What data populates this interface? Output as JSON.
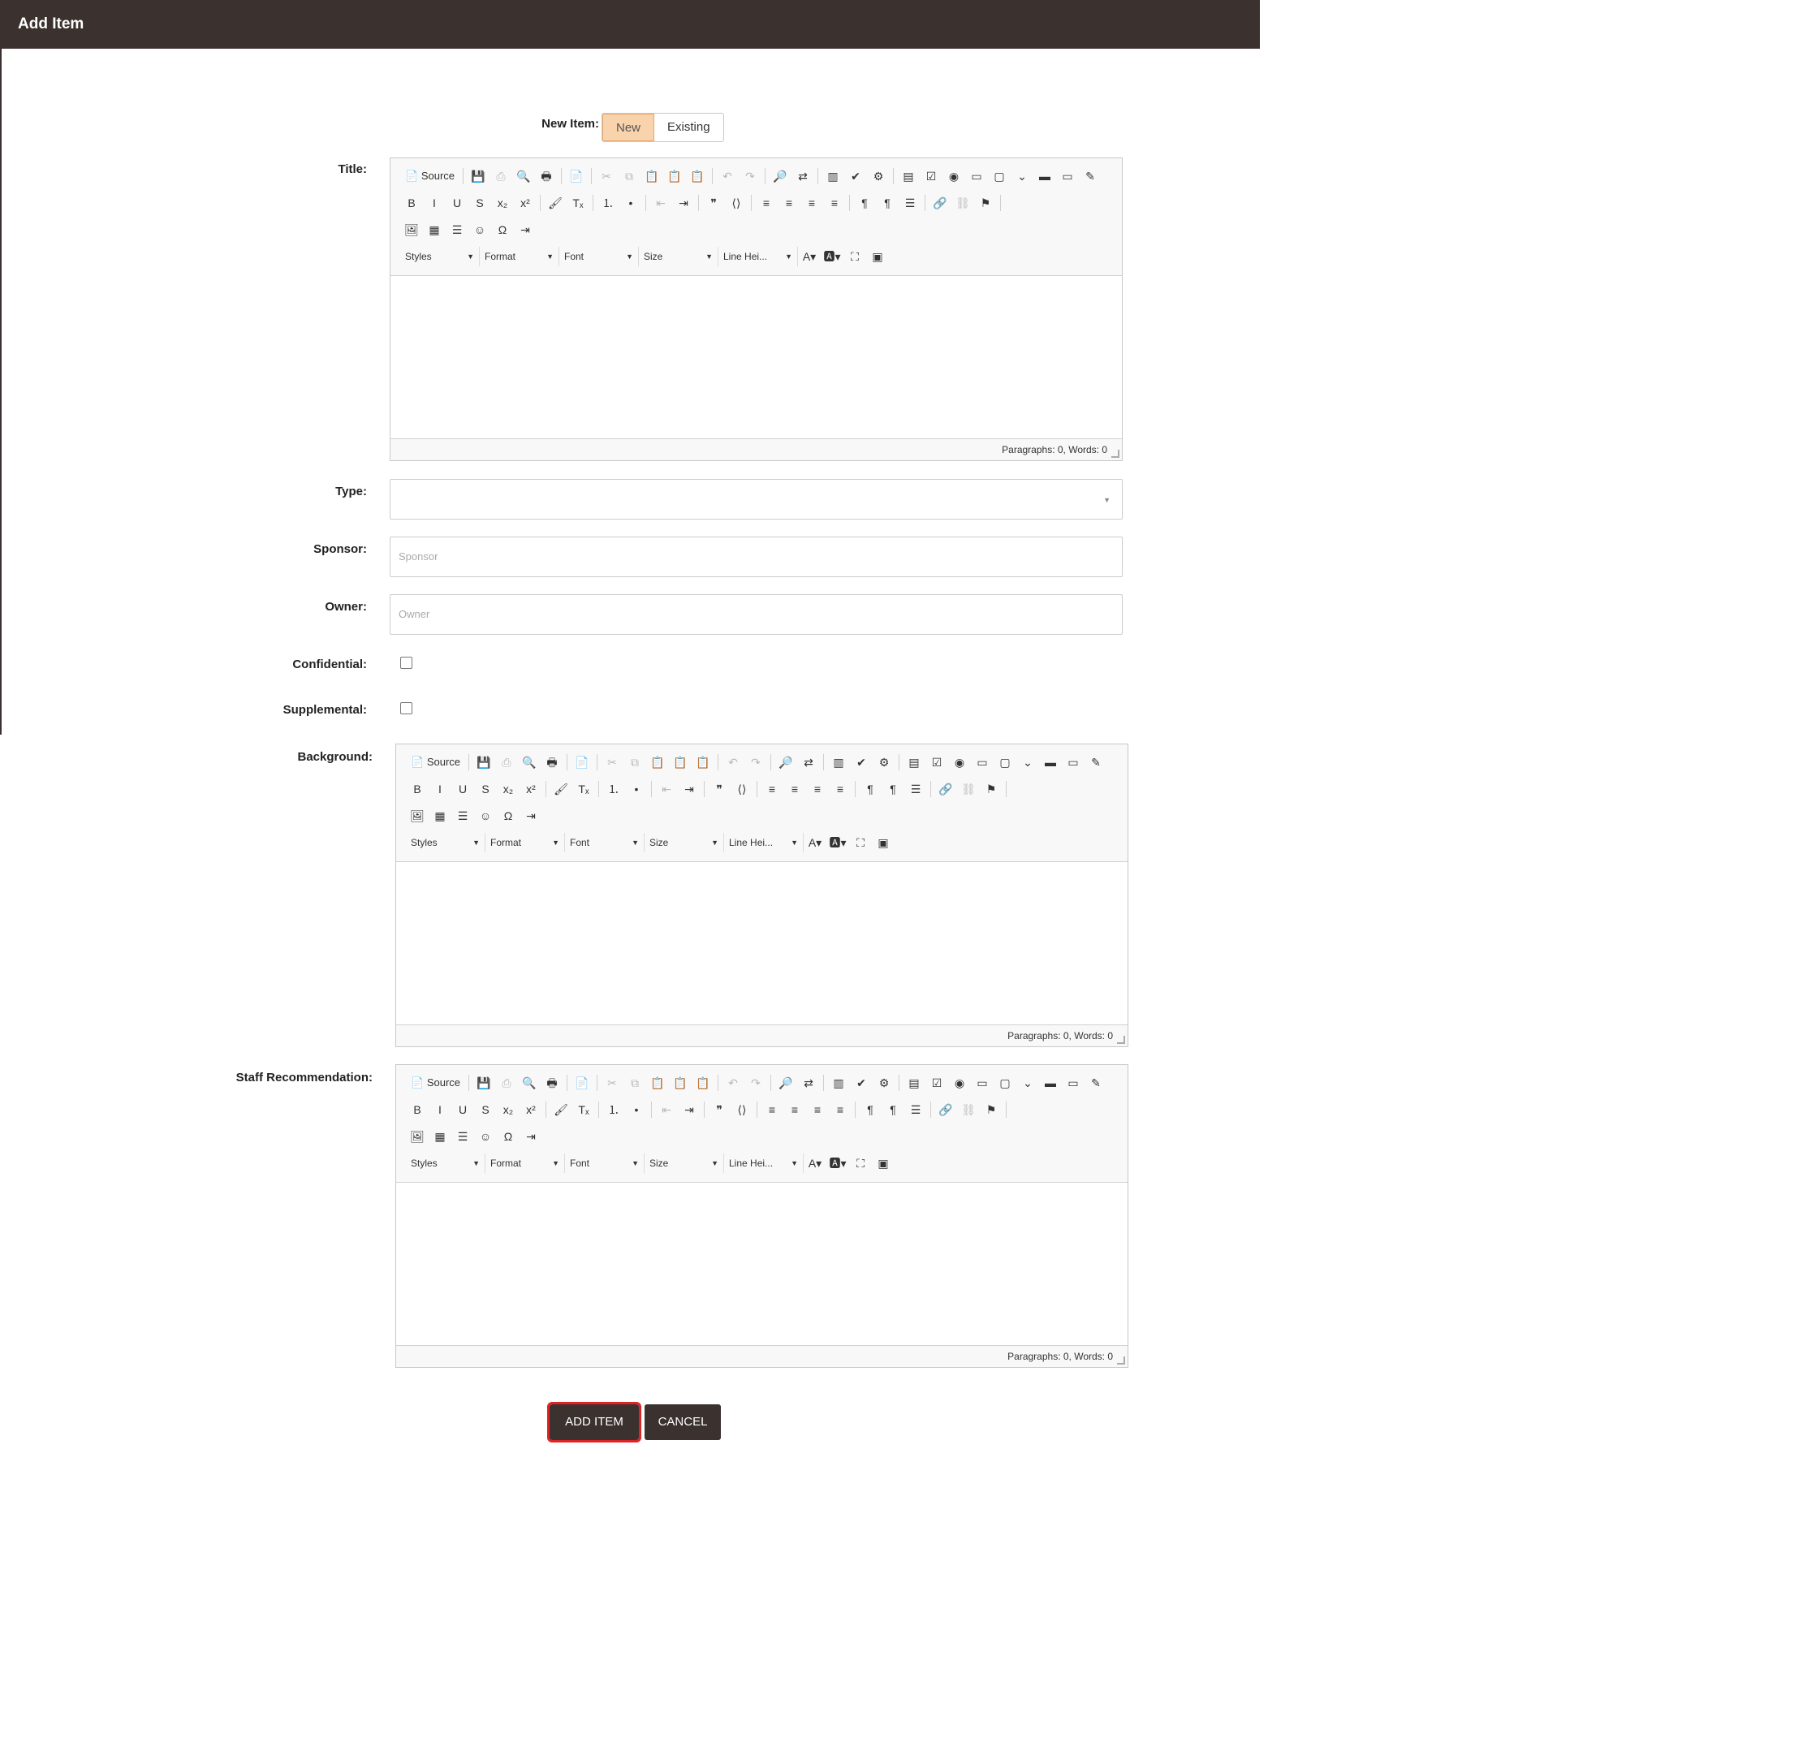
{
  "dialog": {
    "title": "Add Item"
  },
  "new_item": {
    "label": "New Item:",
    "options": [
      "New",
      "Existing"
    ],
    "selected": "New"
  },
  "fields": {
    "title_label": "Title:",
    "type_label": "Type:",
    "sponsor_label": "Sponsor:",
    "sponsor_placeholder": "Sponsor",
    "owner_label": "Owner:",
    "owner_placeholder": "Owner",
    "confidential_label": "Confidential:",
    "supplemental_label": "Supplemental:",
    "background_label": "Background:",
    "staff_label": "Staff Recommendation:"
  },
  "editor": {
    "source_label": "Source",
    "styles_label": "Styles",
    "format_label": "Format",
    "font_label": "Font",
    "size_label": "Size",
    "lineheight_label": "Line Hei...",
    "status_text": "Paragraphs: 0, Words: 0"
  },
  "actions": {
    "add_label": "ADD ITEM",
    "cancel_label": "CANCEL"
  },
  "colors": {
    "header_bg": "#3b3230",
    "toggle_active": "#f9d3ac",
    "focus_outline": "#e12222"
  }
}
